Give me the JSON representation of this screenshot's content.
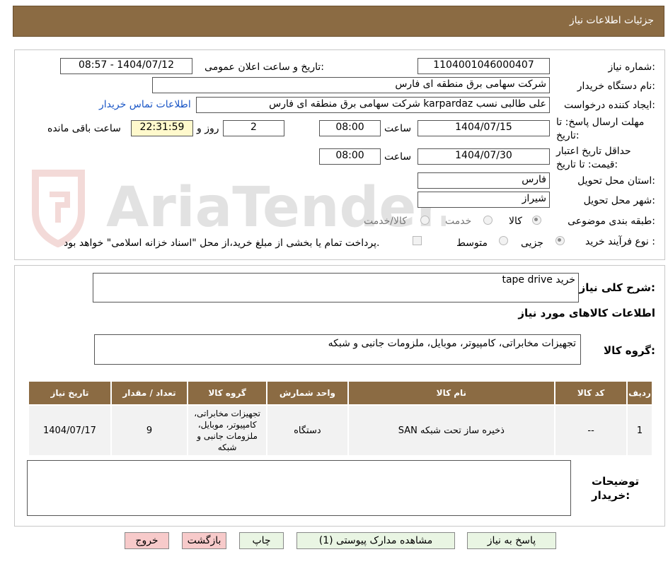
{
  "header": {
    "title": "جزئیات اطلاعات نیاز"
  },
  "details": {
    "need_number_label": "شماره نیاز:",
    "need_number": "1104001046000407",
    "announce_label": "تاریخ و ساعت اعلان عمومی:",
    "announce_value": "1404/07/12 - 08:57",
    "buyer_org_label": "نام دستگاه خریدار:",
    "buyer_org": "شرکت سهامی برق منطقه ای فارس",
    "creator_label": "ایجاد کننده درخواست:",
    "creator": "علی طالبی نسب karpardaz شرکت سهامی برق منطقه ای فارس",
    "contact_link": "اطلاعات تماس خریدار",
    "deadline_label": "مهلت ارسال پاسخ: تا تاریخ:",
    "deadline_date": "1404/07/15",
    "time_label": "ساعت",
    "deadline_time": "08:00",
    "days_value": "2",
    "days_label": "روز و",
    "remaining_time": "22:31:59",
    "remaining_label": "ساعت باقی مانده",
    "validity_label": "حداقل تاریخ اعتبار قیمت: تا تاریخ:",
    "validity_date": "1404/07/30",
    "validity_time": "08:00",
    "province_label": "استان محل تحویل:",
    "province": "فارس",
    "city_label": "شهر محل تحویل:",
    "city": "شیراز",
    "category_label": "طبقه بندی موضوعی:",
    "category_options": [
      "کالا",
      "خدمت",
      "کالا/خدمت"
    ],
    "process_label": "نوع فرآیند خرید :",
    "process_options": [
      "جزیی",
      "متوسط"
    ],
    "payment_note": "پرداخت تمام یا بخشی از مبلغ خرید،از محل \"اسناد خزانه اسلامی\" خواهد بود."
  },
  "summary": {
    "label": "شرح کلی نیاز:",
    "value": "خرید tape drive",
    "goods_info_title": "اطلاعات کالاهای مورد نیاز",
    "group_label": "گروه کالا:",
    "group_value": "تجهیزات مخابراتی، کامپیوتر، موبایل، ملزومات جانبی و شبکه"
  },
  "table": {
    "headers": [
      "ردیف",
      "کد کالا",
      "نام کالا",
      "واحد شمارش",
      "گروه کالا",
      "تعداد / مقدار",
      "تاریخ نیاز"
    ],
    "rows": [
      {
        "row": "1",
        "code": "--",
        "name": "ذخیره ساز تحت شبکه SAN",
        "unit": "دستگاه",
        "group": "تجهیزات مخابراتی، کامپیوتر، موبایل، ملزومات جانبی و شبکه",
        "qty": "9",
        "date": "1404/07/17"
      }
    ]
  },
  "buyer_notes": {
    "label": "توضیحات خریدار:",
    "value": ""
  },
  "buttons": {
    "reply": "پاسخ به نیاز",
    "attachments": "مشاهده مدارک پیوستی (1)",
    "print": "چاپ",
    "back": "بازگشت",
    "exit": "خروج"
  },
  "watermark": {
    "text": "AriaTender.neT"
  },
  "colors": {
    "header_brown": "#8b6b43",
    "link_blue": "#1a56c6",
    "button_green": "#e9f5e3",
    "button_red": "#f7caca"
  }
}
